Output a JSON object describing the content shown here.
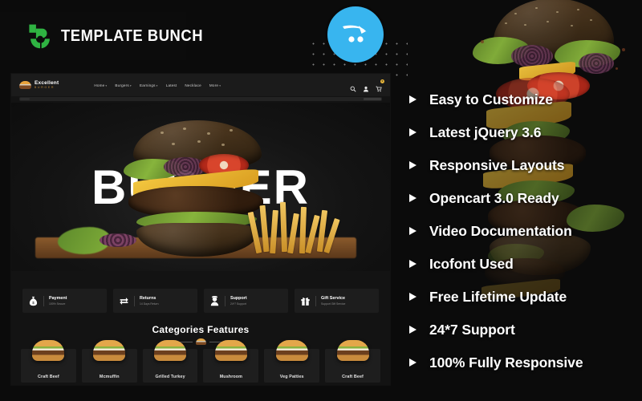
{
  "brand": {
    "logo_text": "TEMPLATE BUNCH",
    "logo_icon": "template-bunch-b-mark",
    "logo_color": "#2fb342"
  },
  "platform_badge": {
    "icon": "opencart-cart-icon",
    "color": "#38b5ef"
  },
  "features": {
    "bullet_icon": "arrow-right-triangle",
    "items": [
      {
        "label": "Easy to Customize"
      },
      {
        "label": "Latest jQuery 3.6"
      },
      {
        "label": "Responsive Layouts"
      },
      {
        "label": "Opencart 3.0 Ready"
      },
      {
        "label": "Video Documentation"
      },
      {
        "label": "Icofont Used"
      },
      {
        "label": "Free Lifetime Update"
      },
      {
        "label": "24*7 Support"
      },
      {
        "label": "100% Fully Responsive"
      }
    ]
  },
  "preview": {
    "site_logo": {
      "name": "Excellent",
      "sub": "BURGER",
      "icon": "burger-logo-icon"
    },
    "nav": [
      {
        "label": "Home",
        "caret": "▾"
      },
      {
        "label": "Burgers",
        "caret": "▾"
      },
      {
        "label": "Earnings",
        "caret": "▾"
      },
      {
        "label": "Latest",
        "caret": ""
      },
      {
        "label": "Necklace",
        "caret": ""
      },
      {
        "label": "More",
        "caret": "▾"
      }
    ],
    "header_icons": [
      {
        "name": "search-icon"
      },
      {
        "name": "user-icon"
      },
      {
        "name": "cart-icon"
      }
    ],
    "cart_count": "0",
    "hero_word": "BURGER",
    "services": [
      {
        "title": "Payment",
        "sub": "100% Secure",
        "icon": "money-bag-icon"
      },
      {
        "title": "Returns",
        "sub": "14 Days Return",
        "icon": "exchange-arrows-icon"
      },
      {
        "title": "Support",
        "sub": "24*7 Support",
        "icon": "headset-support-icon"
      },
      {
        "title": "Gift Service",
        "sub": "Support Gift Service",
        "icon": "gift-box-icon"
      }
    ],
    "categories_title": "Categories Features",
    "categories": [
      {
        "label": "Craft Beef"
      },
      {
        "label": "Mcmuffin"
      },
      {
        "label": "Grilled Turkey"
      },
      {
        "label": "Mushroom"
      },
      {
        "label": "Veg Patties"
      },
      {
        "label": "Craft Beef"
      }
    ]
  }
}
